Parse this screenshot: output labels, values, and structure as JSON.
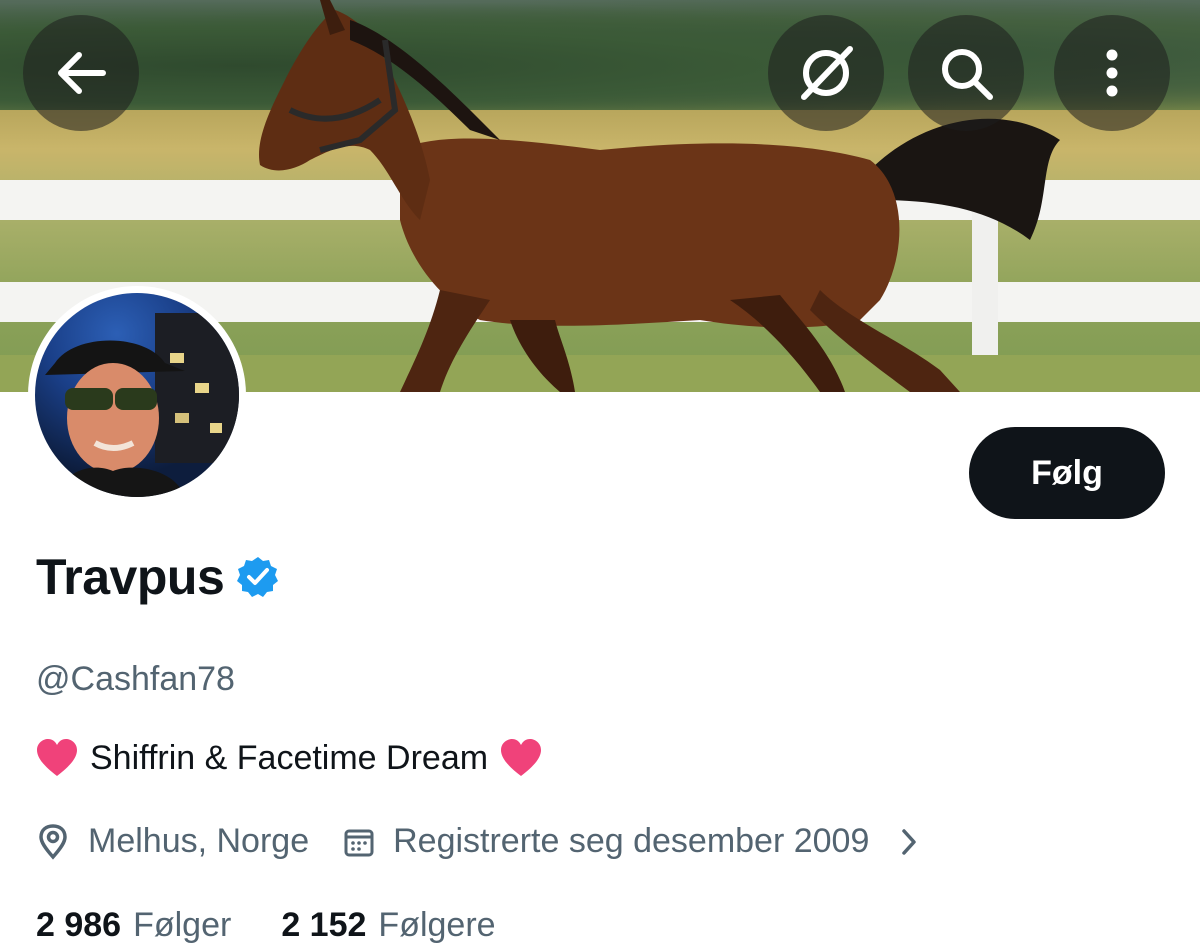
{
  "header": {
    "back_icon": "arrow-left-icon",
    "grok_icon": "slashed-circle-icon",
    "search_icon": "search-icon",
    "more_icon": "vertical-dots-icon"
  },
  "banner": {
    "subject": "bay horse trotting by white fence"
  },
  "profile": {
    "name": "Travpus",
    "verified": true,
    "handle": "@Cashfan78",
    "bio_text": "Shiffrin & Facetime Dream",
    "bio_emoji": "❤️",
    "location": "Melhus, Norge",
    "joined": "Registrerte seg desember 2009",
    "follow_label": "Følg"
  },
  "stats": {
    "following_count": "2 986",
    "following_label": "Følger",
    "followers_count": "2 152",
    "followers_label": "Følgere"
  },
  "colors": {
    "accent": "#1d9bf0",
    "text_primary": "#0f1419",
    "text_secondary": "#536471",
    "heart": "#f0427a"
  }
}
